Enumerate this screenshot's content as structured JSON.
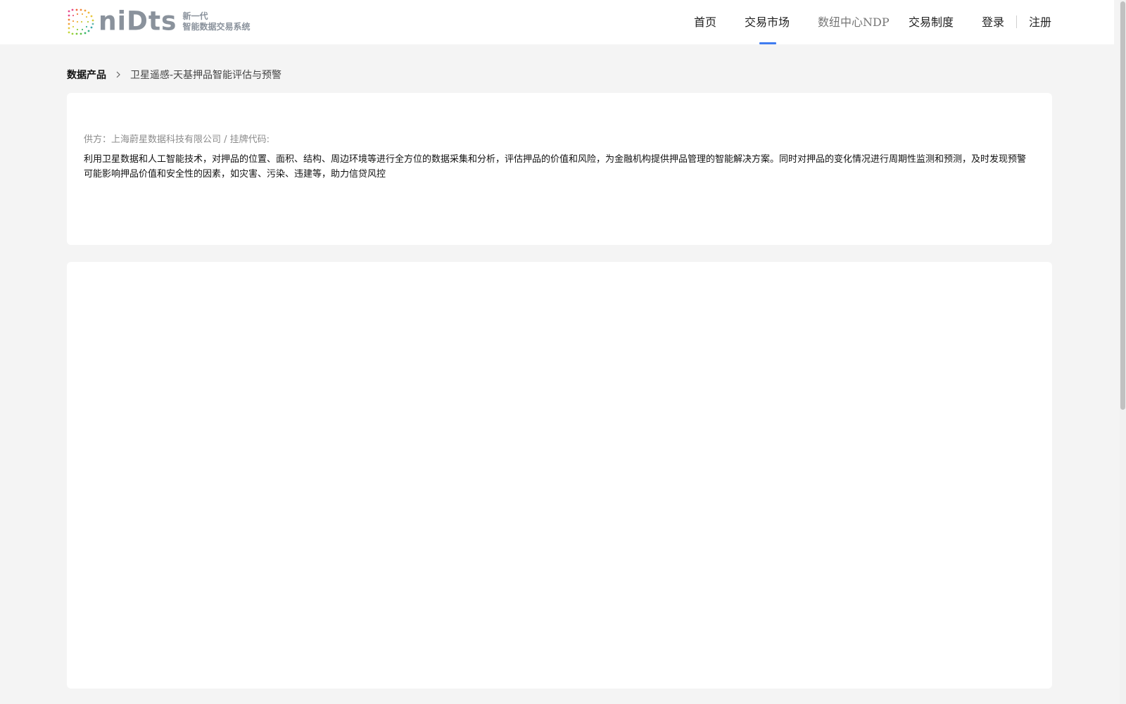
{
  "header": {
    "logo": {
      "wordmark": "niDts",
      "tagline_line1": "新一代",
      "tagline_line2": "智能数据交易系统"
    },
    "nav": {
      "items": [
        {
          "label": "首页"
        },
        {
          "label": "交易市场",
          "active": true
        },
        {
          "label": "数纽中心NDP"
        },
        {
          "label": "交易制度"
        }
      ],
      "login_label": "登录",
      "register_label": "注册"
    },
    "accent_color": "#3f7cf0"
  },
  "breadcrumb": {
    "root": "数据产品",
    "current": "卫星遥感-天基押品智能评估与预警"
  },
  "product": {
    "supplier_line": "供方：上海蔚星数据科技有限公司 / 挂牌代码:",
    "description": "利用卫星数据和人工智能技术，对押品的位置、面积、结构、周边环境等进行全方位的数据采集和分析，评估押品的价值和风险，为金融机构提供押品管理的智能解决方案。同时对押品的变化情况进行周期性监测和预测，及时发现预警可能影响押品价值和安全性的因素，如灾害、污染、违建等，助力信贷风控"
  }
}
